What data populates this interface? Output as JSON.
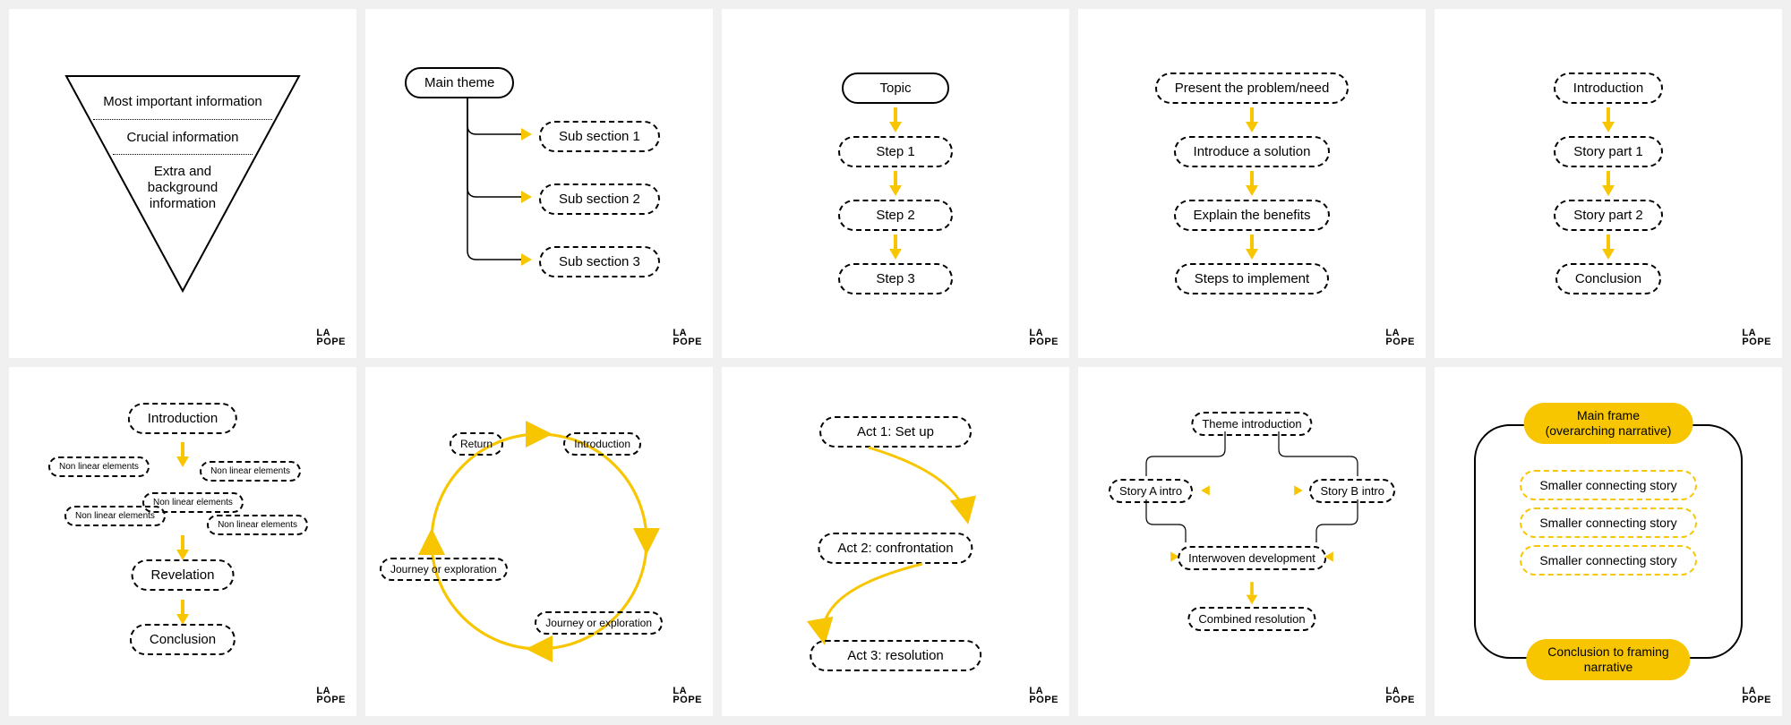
{
  "watermark": "LA\nPOPE",
  "cards": {
    "c1": {
      "lines": [
        "Most important information",
        "Crucial information",
        "Extra and",
        "background",
        "information"
      ]
    },
    "c2": {
      "main": "Main theme",
      "subs": [
        "Sub section 1",
        "Sub section 2",
        "Sub section 3"
      ]
    },
    "c3": {
      "topic": "Topic",
      "steps": [
        "Step 1",
        "Step 2",
        "Step 3"
      ]
    },
    "c4": {
      "steps": [
        "Present the problem/need",
        "Introduce a solution",
        "Explain the benefits",
        "Steps to implement"
      ]
    },
    "c5": {
      "steps": [
        "Introduction",
        "Story part 1",
        "Story part 2",
        "Conclusion"
      ]
    },
    "c6": {
      "intro": "Introduction",
      "nonlinear": "Non linear elements",
      "revelation": "Revelation",
      "conclusion": "Conclusion"
    },
    "c7": {
      "nodes": [
        "Introduction",
        "Journey or exploration",
        "Journey or exploration",
        "Return"
      ]
    },
    "c8": {
      "acts": [
        "Act 1: Set up",
        "Act 2: confrontation",
        "Act 3: resolution"
      ]
    },
    "c9": {
      "theme": "Theme introduction",
      "a": "Story A intro",
      "b": "Story B intro",
      "inter": "Interwoven development",
      "resolution": "Combined resolution"
    },
    "c10": {
      "frame_l1": "Main frame",
      "frame_l2": "(overarching narrative)",
      "stories": [
        "Smaller connecting story",
        "Smaller connecting story",
        "Smaller connecting story"
      ],
      "conc_l1": "Conclusion to framing",
      "conc_l2": "narrative"
    }
  }
}
